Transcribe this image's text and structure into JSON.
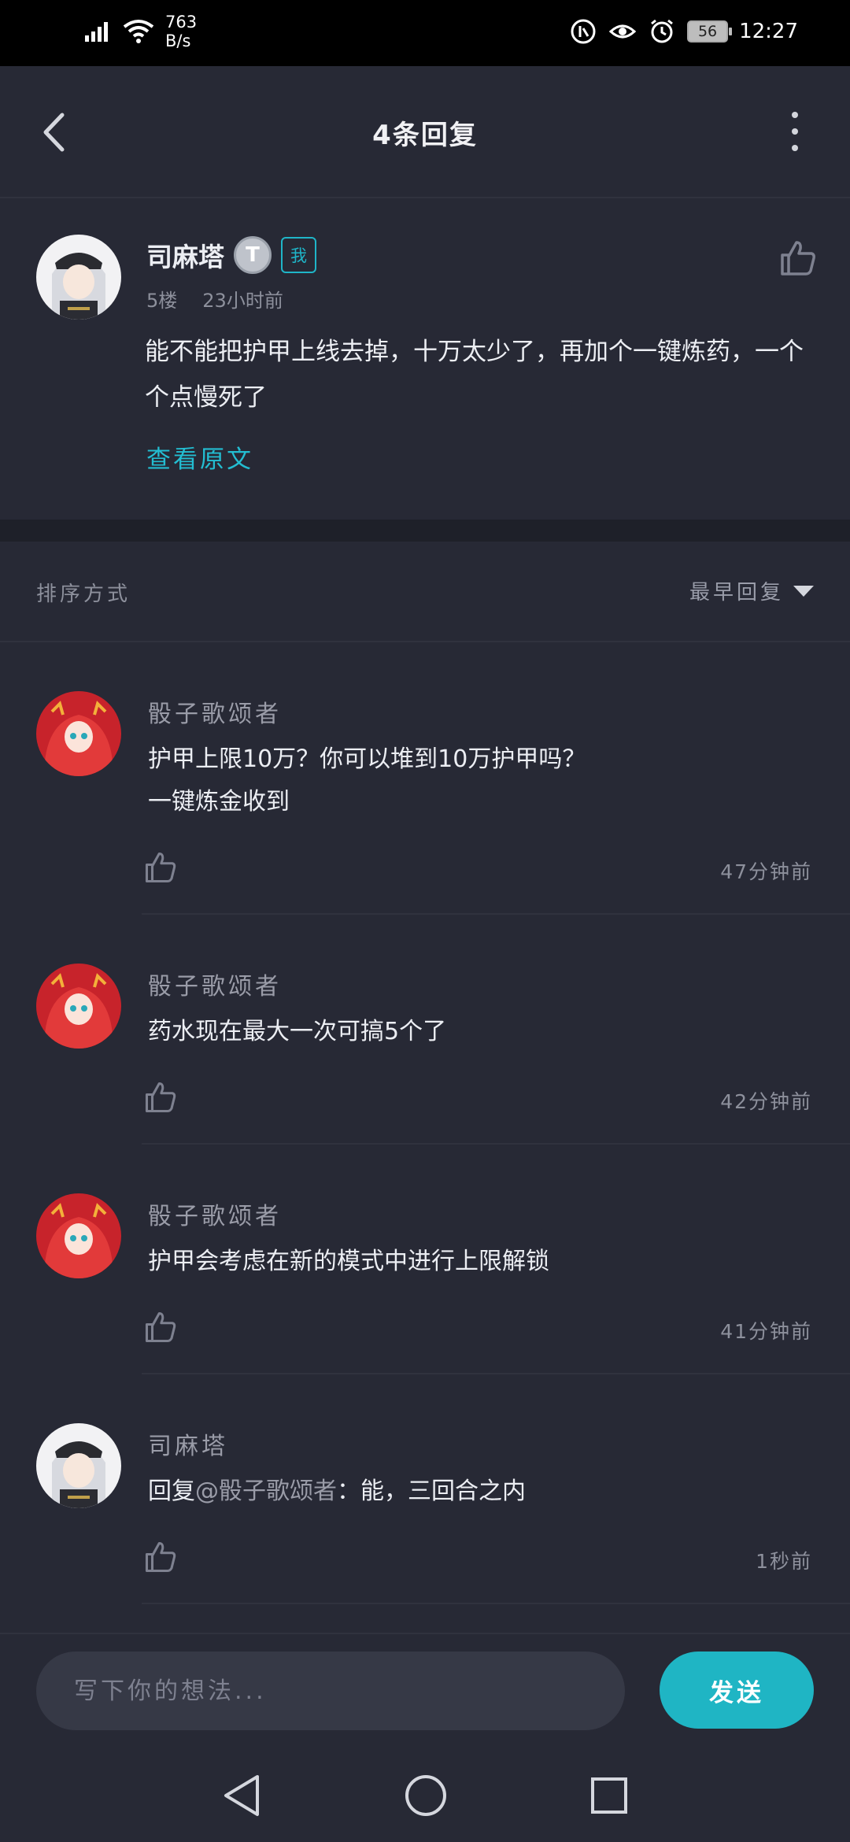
{
  "status_bar": {
    "net_speed_value": "763",
    "net_speed_unit": "B/s",
    "battery": "56",
    "time": "12:27"
  },
  "header": {
    "title": "4条回复"
  },
  "origin_post": {
    "author": "司麻塔",
    "level_badge": "T",
    "me_tag": "我",
    "floor": "5楼",
    "time": "23小时前",
    "text": "能不能把护甲上线去掉，十万太少了，再加个一键炼药，一个个点慢死了",
    "view_original": "查看原文"
  },
  "sort": {
    "label": "排序方式",
    "value": "最早回复"
  },
  "replies": [
    {
      "author": "骰子歌颂者",
      "line1": "护甲上限10万？你可以堆到10万护甲吗？",
      "line2": "一键炼金收到",
      "time": "47分钟前"
    },
    {
      "author": "骰子歌颂者",
      "line1": "药水现在最大一次可搞5个了",
      "time": "42分钟前"
    },
    {
      "author": "骰子歌颂者",
      "line1": "护甲会考虑在新的模式中进行上限解锁",
      "time": "41分钟前"
    },
    {
      "author": "司麻塔",
      "prefix": "回复",
      "mention": "@骰子歌颂者",
      "line1": "：能，三回合之内",
      "time": "1秒前"
    }
  ],
  "compose": {
    "placeholder": "写下你的想法...",
    "send_label": "发送"
  },
  "colors": {
    "accent": "#1fb5c4",
    "background": "#272935"
  }
}
